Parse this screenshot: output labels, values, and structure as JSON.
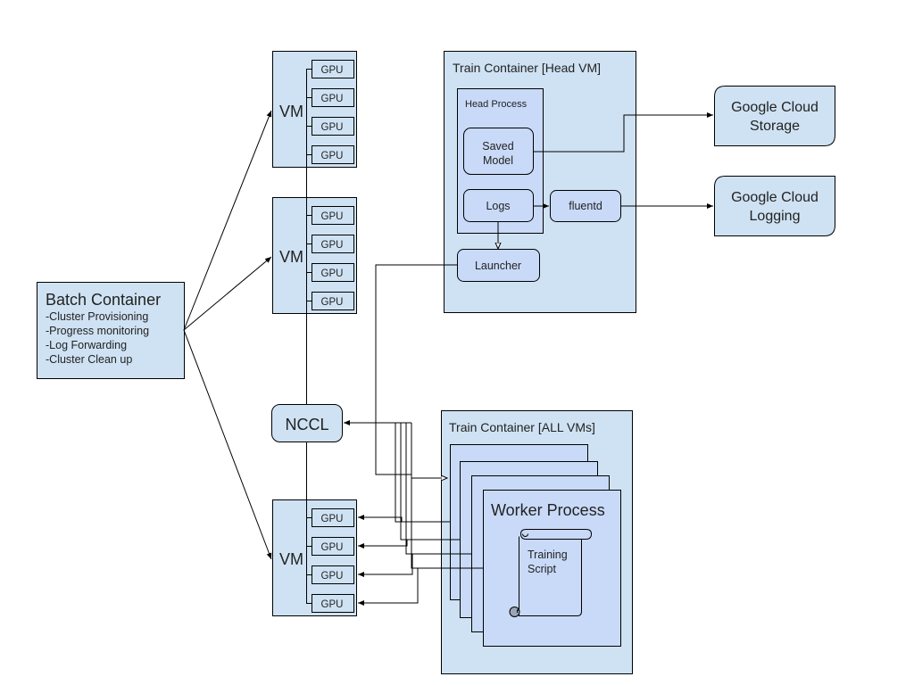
{
  "batch_container": {
    "title": "Batch Container",
    "items": [
      "-Cluster Provisioning",
      "-Progress monitoring",
      "-Log Forwarding",
      "-Cluster Clean up"
    ]
  },
  "vms": [
    {
      "label": "VM",
      "gpus": [
        "GPU",
        "GPU",
        "GPU",
        "GPU"
      ]
    },
    {
      "label": "VM",
      "gpus": [
        "GPU",
        "GPU",
        "GPU",
        "GPU"
      ]
    },
    {
      "label": "VM",
      "gpus": [
        "GPU",
        "GPU",
        "GPU",
        "GPU"
      ]
    }
  ],
  "nccl": {
    "label": "NCCL"
  },
  "head_container": {
    "title": "Train Container [Head VM]",
    "head_process": {
      "title": "Head Process",
      "saved_model": [
        "Saved",
        "Model"
      ],
      "logs": "Logs"
    },
    "fluentd": "fluentd",
    "launcher": "Launcher"
  },
  "cloud_storage": [
    "Google Cloud",
    "Storage"
  ],
  "cloud_logging": [
    "Google Cloud",
    "Logging"
  ],
  "all_vms_container": {
    "title": "Train Container [ALL VMs]",
    "worker_process": "Worker Process",
    "training_script": [
      "Training",
      "Script"
    ]
  }
}
